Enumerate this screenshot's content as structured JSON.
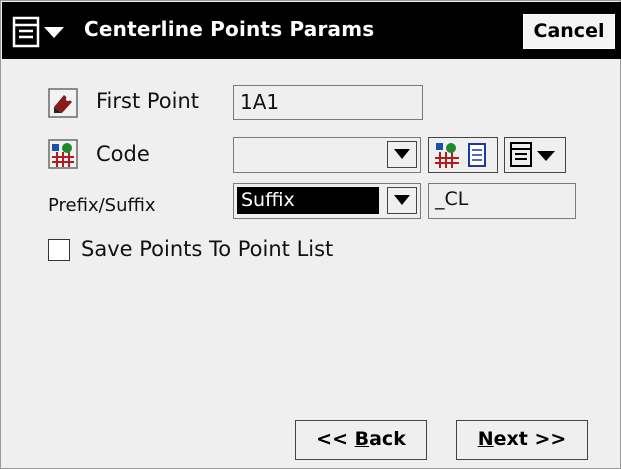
{
  "titlebar": {
    "title": "Centerline Points Params",
    "cancel_label": "Cancel"
  },
  "form": {
    "first_point": {
      "label": "First Point",
      "value": "1A1"
    },
    "code": {
      "label": "Code",
      "value": ""
    },
    "prefix_suffix": {
      "label": "Prefix/Suffix",
      "mode": "Suffix",
      "value": "_CL"
    },
    "save_points": {
      "label": "Save Points To Point List",
      "checked": false
    }
  },
  "footer": {
    "back": {
      "prefix": "<< ",
      "accel": "B",
      "rest": "ack"
    },
    "next": {
      "accel": "N",
      "rest": "ext >>"
    }
  },
  "icons": [
    "menu-icon",
    "pencil-point-icon",
    "code-icon",
    "code-list-icon",
    "dropdown-menu-icon"
  ]
}
